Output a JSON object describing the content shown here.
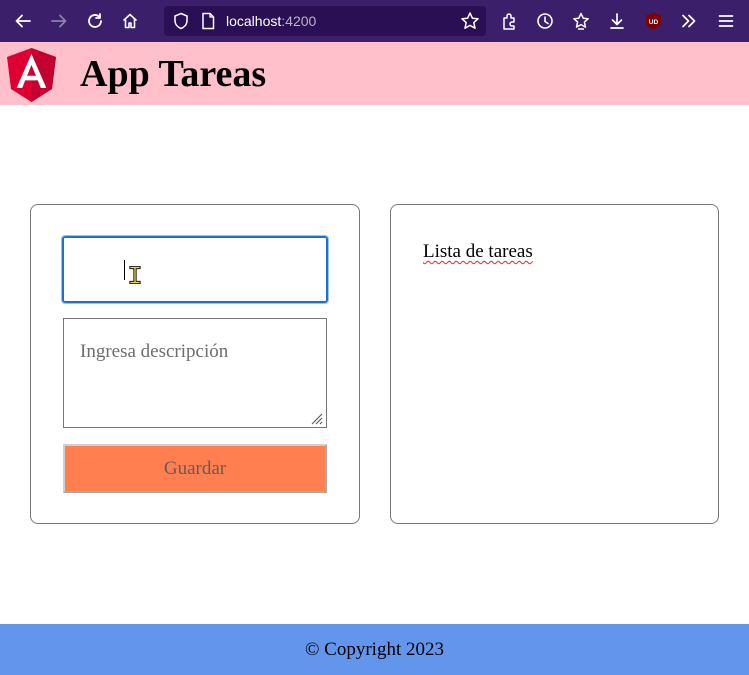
{
  "browser": {
    "url_host": "localhost",
    "url_port": ":4200",
    "icons": [
      "back-icon",
      "forward-icon",
      "reload-icon",
      "home-icon",
      "shield-icon",
      "page-icon",
      "bookmark-star-icon",
      "extensions-icon",
      "history-icon",
      "bookmarks-icon",
      "downloads-icon",
      "ublock-icon",
      "overflow-chevrons-icon",
      "menu-icon"
    ],
    "colors": {
      "toolbar": "#3b1f6b",
      "urlbar": "#2a0f55"
    }
  },
  "header": {
    "title": "App Tareas",
    "logo": "angular-logo",
    "background": "#ffc0cb"
  },
  "form": {
    "title_value": "",
    "description_placeholder": "Ingresa descripción",
    "save_label": "Guardar",
    "button_color": "#ff7f50"
  },
  "list": {
    "title": "Lista de tareas"
  },
  "footer": {
    "text": "© Copyright 2023",
    "background": "#6495ed"
  }
}
